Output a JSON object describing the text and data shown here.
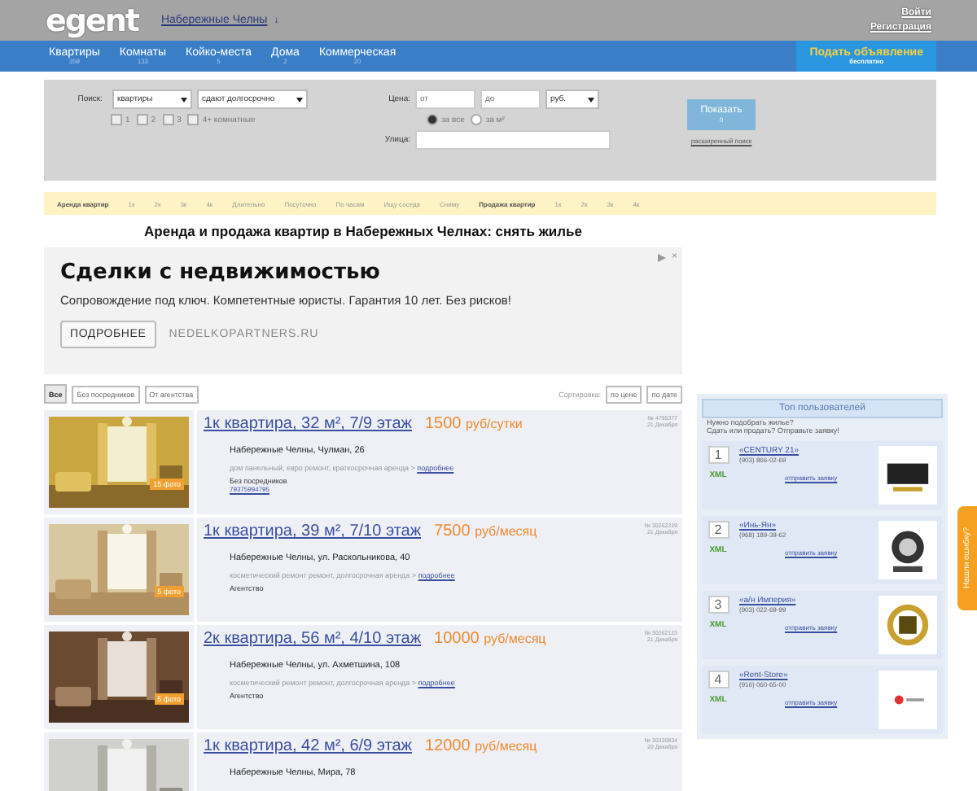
{
  "header": {
    "logo": "egent",
    "city": "Набережные Челны",
    "city_caret": "↓",
    "login": "Войти",
    "register": "Регистрация"
  },
  "nav": {
    "items": [
      {
        "label": "Квартиры",
        "count": "359"
      },
      {
        "label": "Комнаты",
        "count": "133"
      },
      {
        "label": "Койко-места",
        "count": "5"
      },
      {
        "label": "Дома",
        "count": "2"
      },
      {
        "label": "Коммерческая",
        "count": "20"
      }
    ],
    "post_button": {
      "label": "Подать объявление",
      "sub": "бесплатно"
    }
  },
  "search": {
    "label": "Поиск:",
    "type_select": "квартиры",
    "deal_select": "сдают долгосрочно",
    "rooms": [
      {
        "label": "1",
        "checked": false
      },
      {
        "label": "2",
        "checked": false
      },
      {
        "label": "3",
        "checked": false
      },
      {
        "label": "4+ комнатные",
        "checked": false
      }
    ],
    "price_label": "Цена:",
    "price_from": {
      "placeholder": "от"
    },
    "price_to": {
      "placeholder": "до"
    },
    "currency": "руб.",
    "price_mode": [
      {
        "label": "за все",
        "selected": true
      },
      {
        "label": "за м²",
        "selected": false
      }
    ],
    "street_label": "Улица:",
    "show_button": {
      "label": "Показать",
      "sub": "0"
    },
    "advanced_link": "расширенный поиск"
  },
  "quick_links": [
    {
      "label": "Аренда квартир",
      "kind": "heading"
    },
    {
      "label": "1к",
      "kind": "link"
    },
    {
      "label": "2к",
      "kind": "link"
    },
    {
      "label": "3к",
      "kind": "link"
    },
    {
      "label": "4к",
      "kind": "link"
    },
    {
      "label": "Длительно",
      "kind": "link"
    },
    {
      "label": "Посуточно",
      "kind": "link"
    },
    {
      "label": "По часам",
      "kind": "link"
    },
    {
      "label": "Ищу соседа",
      "kind": "link"
    },
    {
      "label": "Сниму",
      "kind": "link"
    },
    {
      "label": "Продажа квартир",
      "kind": "heading"
    },
    {
      "label": "1к",
      "kind": "link"
    },
    {
      "label": "2к",
      "kind": "link"
    },
    {
      "label": "3к",
      "kind": "link"
    },
    {
      "label": "4к",
      "kind": "link"
    }
  ],
  "page_title": "Аренда и продажа квартир в Набережных Челнах: снять жилье",
  "ad": {
    "title": "Сделки с недвижимостью",
    "text": "Сопровождение под ключ. Компетентные юристы. Гарантия 10 лет. Без рисков!",
    "button": "ПОДРОБНЕЕ",
    "domain": "NEDELKOPARTNERS.RU",
    "close": "×"
  },
  "filters": [
    {
      "label": "Все",
      "selected": true
    },
    {
      "label": "Без посредников",
      "selected": false
    },
    {
      "label": "От агентства",
      "selected": false
    }
  ],
  "sort": {
    "label": "Сортировка:",
    "options": [
      {
        "label": "по цене",
        "selected": false
      },
      {
        "label": "по дате",
        "selected": false
      }
    ]
  },
  "listings": [
    {
      "title": "1к квартира, 32 м², 7/9 этаж",
      "price": "1500",
      "unit": "руб/сутки",
      "number": "№ 4795377",
      "date": "21 Декабря",
      "address": "Набережные Челны, Чулман, 26",
      "description": "дом панельный, евро ремонт, краткосрочная аренда > ",
      "more": "подробнее",
      "seller": "Без посредников",
      "phone": "79375994795",
      "photos": "15 фото"
    },
    {
      "title": "1к квартира, 39 м², 7/10 этаж",
      "price": "7500",
      "unit": "руб/месяц",
      "number": "№ 30262319",
      "date": "21 Декабря",
      "address": "Набережные Челны, ул. Раскольникова, 40",
      "description": "косметический ремонт ремонт, долгосрочная аренда > ",
      "more": "подробнее",
      "seller": "Агентство",
      "photos": "5 фото"
    },
    {
      "title": "2к квартира, 56 м², 4/10 этаж",
      "price": "10000",
      "unit": "руб/месяц",
      "number": "№ 30262123",
      "date": "21 Декабря",
      "address": "Набережные Челны, ул. Ахметшина, 108",
      "description": "косметический ремонт ремонт, долгосрочная аренда > ",
      "more": "подробнее",
      "seller": "Агентство",
      "photos": "5 фото"
    },
    {
      "title": "1к квартира, 42 м², 6/9 этаж",
      "price": "12000",
      "unit": "руб/месяц",
      "number": "№ 30320834",
      "date": "20 Декабря",
      "address": "Набережные Челны, Мира, 78"
    }
  ],
  "sidebar": {
    "title": "Топ пользователей",
    "intro": "Нужно подобрать жилье?",
    "intro2": "Сдать или продать? Отправьте заявку!",
    "agencies": [
      {
        "rank": "1",
        "name": "«CENTURY 21»",
        "phone": "(903) 866-02-69",
        "xml": "XML",
        "request": "отправить заявку"
      },
      {
        "rank": "2",
        "name": "«Инь-Ян»",
        "phone": "(968) 189-39-62",
        "xml": "XML",
        "request": "отправить заявку"
      },
      {
        "rank": "3",
        "name": "«а/н Империя»",
        "phone": "(903) 022-69-99",
        "xml": "XML",
        "request": "отправить заявку"
      },
      {
        "rank": "4",
        "name": "«Rent-Store»",
        "phone": "(916) 060-65-00",
        "xml": "XML",
        "request": "отправить заявку"
      }
    ]
  },
  "feedback_tab": "Нашли ошибку?"
}
